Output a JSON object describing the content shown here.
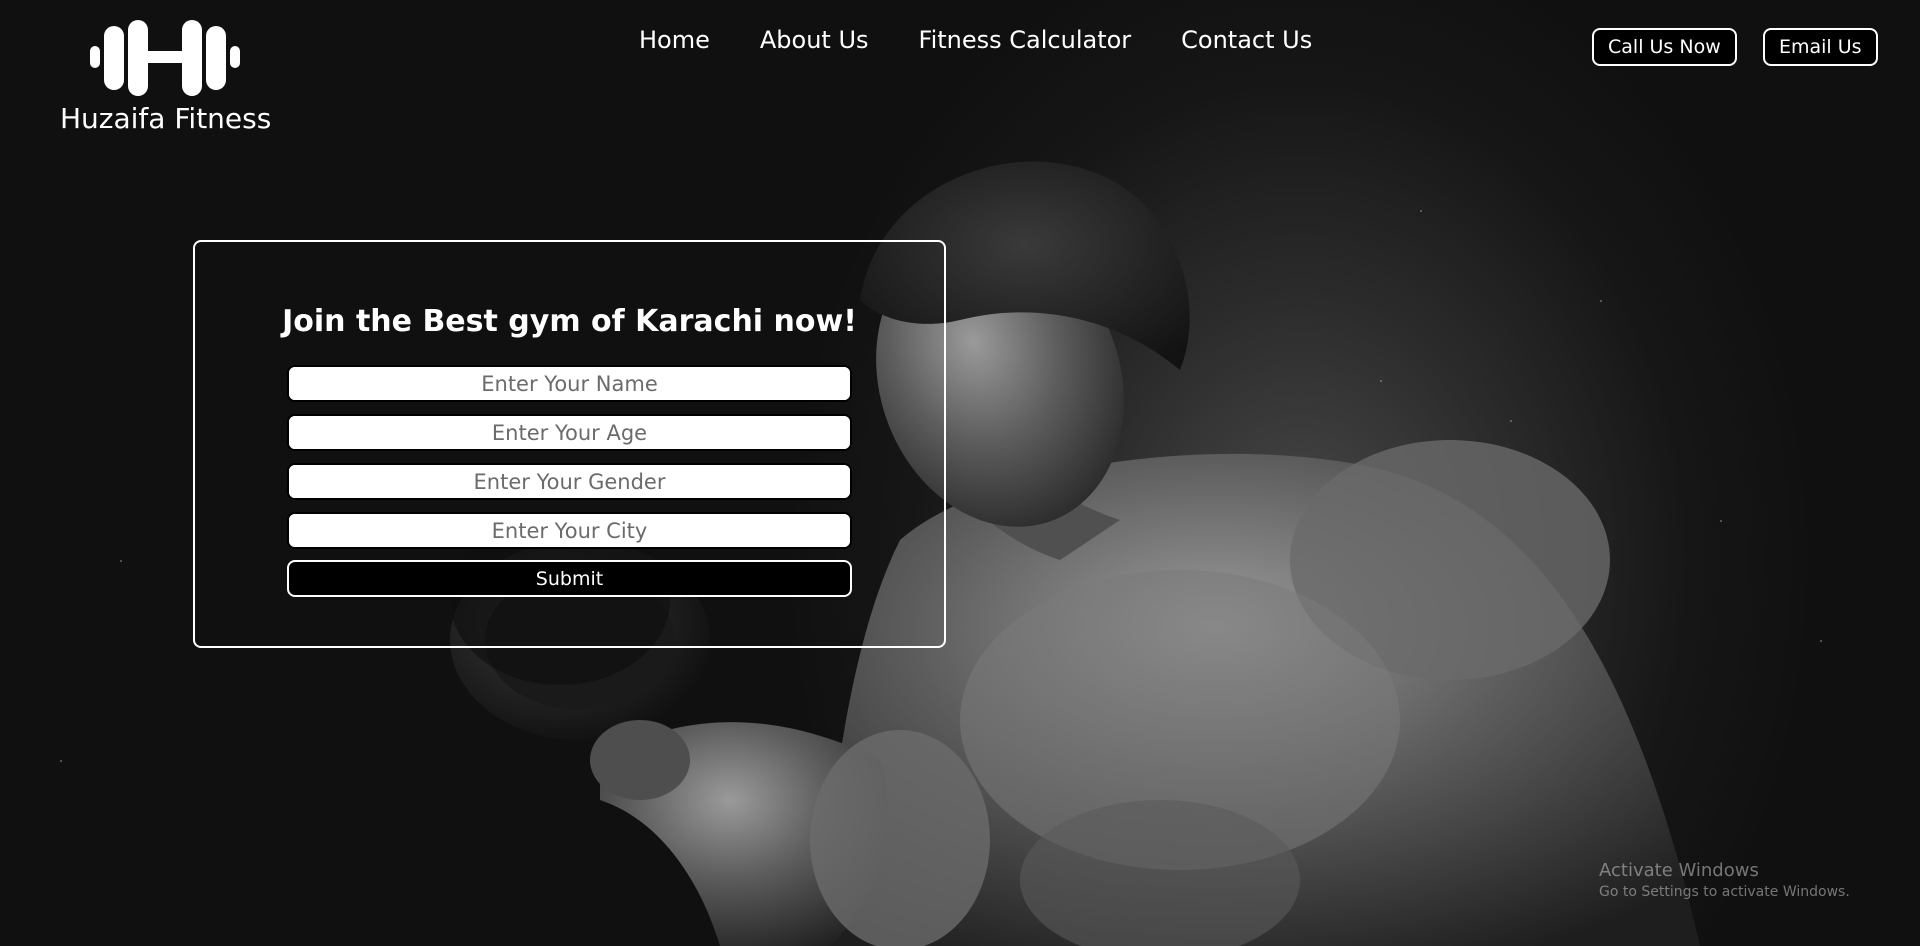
{
  "brand": {
    "name": "Huzaifa Fitness",
    "icon": "dumbbell-icon"
  },
  "nav": {
    "items": [
      {
        "label": "Home"
      },
      {
        "label": "About Us"
      },
      {
        "label": "Fitness Calculator"
      },
      {
        "label": "Contact Us"
      }
    ]
  },
  "header": {
    "call_label": "Call Us Now",
    "email_label": "Email Us"
  },
  "form": {
    "title": "Join the Best gym of Karachi now!",
    "name_placeholder": "Enter Your Name",
    "age_placeholder": "Enter Your Age",
    "gender_placeholder": "Enter Your Gender",
    "city_placeholder": "Enter Your City",
    "submit_label": "Submit"
  },
  "watermark": {
    "title": "Activate Windows",
    "subtitle": "Go to Settings to activate Windows."
  },
  "colors": {
    "background": "#101010",
    "text": "#ffffff",
    "button_bg": "#000000",
    "border": "#ffffff"
  }
}
